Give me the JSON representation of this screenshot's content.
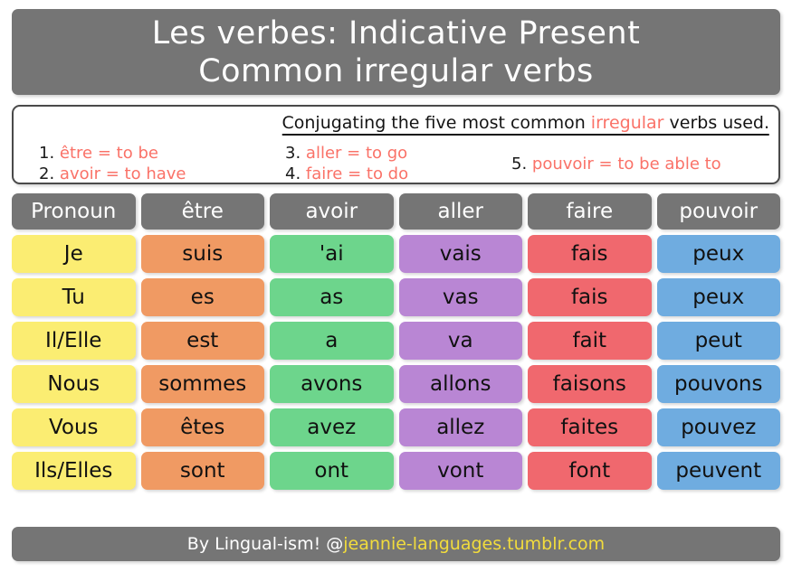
{
  "title": {
    "line1": "Les verbes: Indicative Present",
    "line2": "Common irregular verbs"
  },
  "legend": {
    "heading_before": "Conjugating the five most common ",
    "heading_highlight": "irregular",
    "heading_after": " verbs used.",
    "items": [
      {
        "num": "1.",
        "text": "être = to be"
      },
      {
        "num": "2.",
        "text": "avoir = to have"
      },
      {
        "num": "3.",
        "text": "aller = to go"
      },
      {
        "num": "4.",
        "text": "faire = to do"
      },
      {
        "num": "5.",
        "text": "pouvoir = to be able to"
      }
    ]
  },
  "table": {
    "headers": [
      "Pronoun",
      "être",
      "avoir",
      "aller",
      "faire",
      "pouvoir"
    ],
    "rows": [
      [
        "Je",
        "suis",
        "'ai",
        "vais",
        "fais",
        "peux"
      ],
      [
        "Tu",
        "es",
        "as",
        "vas",
        "fais",
        "peux"
      ],
      [
        "Il/Elle",
        "est",
        "a",
        "va",
        "fait",
        "peut"
      ],
      [
        "Nous",
        "sommes",
        "avons",
        "allons",
        "faisons",
        "pouvons"
      ],
      [
        "Vous",
        "êtes",
        "avez",
        "allez",
        "faites",
        "pouvez"
      ],
      [
        "Ils/Elles",
        "sont",
        "ont",
        "vont",
        "font",
        "peuvent"
      ]
    ],
    "column_colors": [
      "#fbed72",
      "#f09a63",
      "#6dd58c",
      "#b986d4",
      "#f0686e",
      "#6face0"
    ],
    "header_color": "#757575",
    "header_text_color": "#ffffff"
  },
  "footer": {
    "credit": "By Lingual-ism! @",
    "handle": "jeannie-languages.tumblr.com"
  },
  "colors": {
    "banner": "#757575",
    "accent_red": "#fa7268",
    "handle_yellow": "#f2dc3c",
    "page_background": "#ffffff"
  }
}
